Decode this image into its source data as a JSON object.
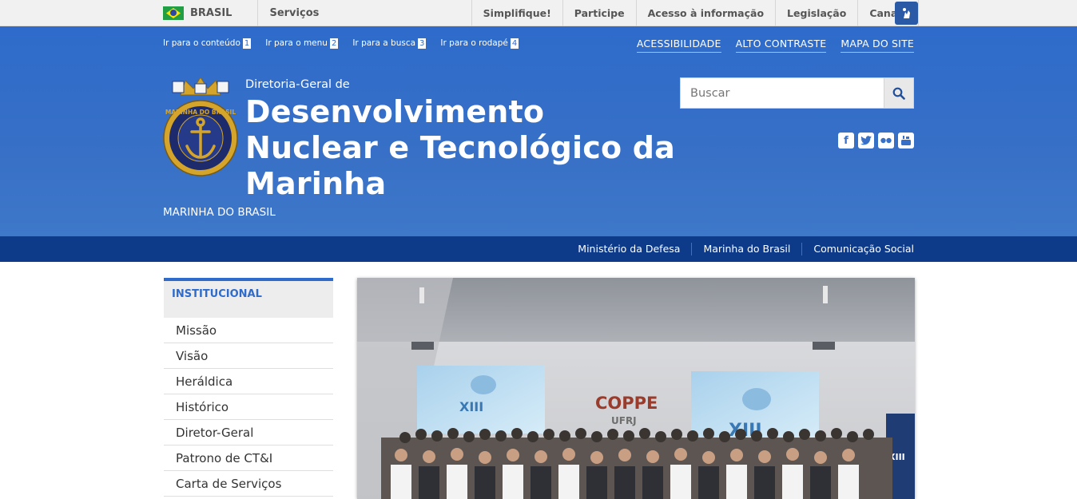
{
  "govbar": {
    "country": "BRASIL",
    "services": "Serviços",
    "links": [
      "Simplifique!",
      "Participe",
      "Acesso à informação",
      "Legislação",
      "Canais"
    ]
  },
  "skip_links": [
    {
      "label": "Ir para o conteúdo",
      "key": "1"
    },
    {
      "label": "Ir para o menu",
      "key": "2"
    },
    {
      "label": "Ir para a busca",
      "key": "3"
    },
    {
      "label": "Ir para o rodapé",
      "key": "4"
    }
  ],
  "accessibility": {
    "a11y": "ACESSIBILIDADE",
    "contrast": "ALTO CONTRASTE",
    "sitemap": "MAPA DO SITE"
  },
  "site": {
    "subtitle": "Diretoria-Geral de",
    "title": "Desenvolvimento Nuclear e Tecnológico da Marinha",
    "org": "MARINHA DO BRASIL",
    "emblem_text": "MARINHA DO BRASIL"
  },
  "search": {
    "placeholder": "Buscar"
  },
  "social": [
    "facebook-icon",
    "twitter-icon",
    "flickr-icon",
    "youtube-icon"
  ],
  "services_bar": [
    "Ministério da Defesa",
    "Marinha do Brasil",
    "Comunicação Social"
  ],
  "sidebar": {
    "heading": "INSTITUCIONAL",
    "items": [
      "Missão",
      "Visão",
      "Heráldica",
      "Histórico",
      "Diretor-Geral",
      "Patrono de CT&I",
      "Carta de Serviços"
    ]
  },
  "photo": {
    "wall_text": "COPPE",
    "wall_sub": "UFRJ",
    "screen_text": "XIII",
    "banner_text": "XIII"
  },
  "colors": {
    "header_blue": "#2e6bcb",
    "services_navy": "#0e3a8a"
  }
}
